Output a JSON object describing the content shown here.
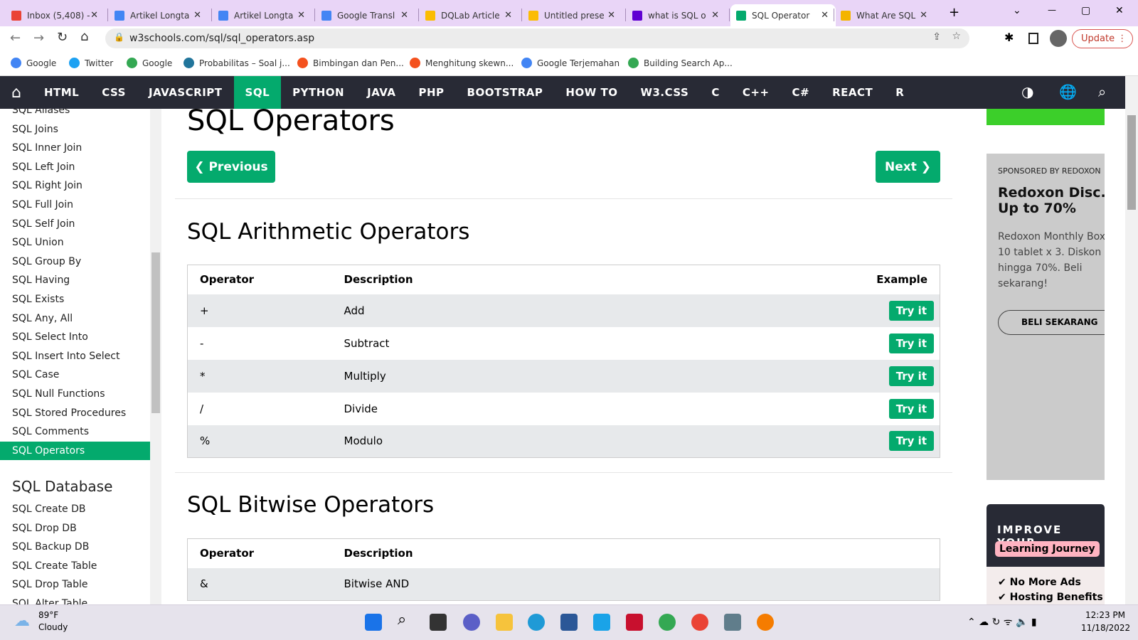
{
  "browser": {
    "tabs": [
      {
        "title": "Inbox (5,408) -",
        "color": "#ea4335"
      },
      {
        "title": "Artikel Longta",
        "color": "#4285f4"
      },
      {
        "title": "Artikel Longta",
        "color": "#4285f4"
      },
      {
        "title": "Google Transl",
        "color": "#4285f4"
      },
      {
        "title": "DQLab Article",
        "color": "#fbbc04"
      },
      {
        "title": "Untitled prese",
        "color": "#fbbc04"
      },
      {
        "title": "what is SQL o",
        "color": "#6001d2"
      },
      {
        "title": "SQL Operator",
        "color": "#04aa6d"
      },
      {
        "title": "What Are SQL",
        "color": "#f4b400"
      }
    ],
    "active_tab": 7,
    "url": "w3schools.com/sql/sql_operators.asp",
    "update_label": "Update",
    "bookmarks": [
      {
        "label": "Google",
        "color": "#4285f4"
      },
      {
        "label": "Twitter",
        "color": "#1da1f2"
      },
      {
        "label": "Google",
        "color": "#34a853"
      },
      {
        "label": "Probabilitas – Soal j...",
        "color": "#21759b"
      },
      {
        "label": "Bimbingan dan Pen...",
        "color": "#f4511e"
      },
      {
        "label": "Menghitung skewn...",
        "color": "#f4511e"
      },
      {
        "label": "Google Terjemahan",
        "color": "#4285f4"
      },
      {
        "label": "Building Search Ap...",
        "color": "#34a853"
      }
    ]
  },
  "nav": {
    "items": [
      "HTML",
      "CSS",
      "JAVASCRIPT",
      "SQL",
      "PYTHON",
      "JAVA",
      "PHP",
      "BOOTSTRAP",
      "HOW TO",
      "W3.CSS",
      "C",
      "C++",
      "C#",
      "REACT",
      "R"
    ],
    "active": "SQL"
  },
  "sidebar": {
    "items": [
      "SQL Aliases",
      "SQL Joins",
      "SQL Inner Join",
      "SQL Left Join",
      "SQL Right Join",
      "SQL Full Join",
      "SQL Self Join",
      "SQL Union",
      "SQL Group By",
      "SQL Having",
      "SQL Exists",
      "SQL Any, All",
      "SQL Select Into",
      "SQL Insert Into Select",
      "SQL Case",
      "SQL Null Functions",
      "SQL Stored Procedures",
      "SQL Comments",
      "SQL Operators"
    ],
    "active": "SQL Operators",
    "section": "SQL Database",
    "db_items": [
      "SQL Create DB",
      "SQL Drop DB",
      "SQL Backup DB",
      "SQL Create Table",
      "SQL Drop Table",
      "SQL Alter Table"
    ]
  },
  "main": {
    "title": "SQL Operators",
    "prev": "❮ Previous",
    "next": "Next ❯",
    "arith": {
      "heading": "SQL Arithmetic Operators",
      "headers": [
        "Operator",
        "Description",
        "Example"
      ],
      "rows": [
        [
          "+",
          "Add"
        ],
        [
          "-",
          "Subtract"
        ],
        [
          "*",
          "Multiply"
        ],
        [
          "/",
          "Divide"
        ],
        [
          "%",
          "Modulo"
        ]
      ],
      "try": "Try it"
    },
    "bitwise": {
      "heading": "SQL Bitwise Operators",
      "headers": [
        "Operator",
        "Description"
      ],
      "rows": [
        [
          "&",
          "Bitwise AND"
        ]
      ]
    }
  },
  "ads": {
    "sponsor": "SPONSORED BY REDOXON",
    "headline": "Redoxon Disc. Up to 70%",
    "body": "Redoxon Monthly Box 10 tablet x 3. Diskon hingga 70%. Beli sekarang!",
    "cta": "BELI SEKARANG",
    "promo_title": "IMPROVE YOUR",
    "promo_badge": "Learning Journey",
    "promo_items": [
      "No More Ads",
      "Hosting Benefits"
    ]
  },
  "taskbar": {
    "temp": "89°F",
    "weather": "Cloudy",
    "time": "12:23 PM",
    "date": "11/18/2022"
  }
}
